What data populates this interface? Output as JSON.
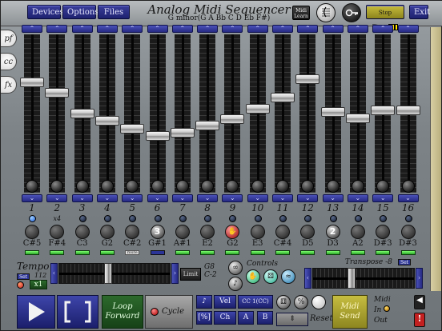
{
  "header": {
    "title": "Analog Midi Sequencer",
    "scale": "G minor(G A Bb C D Eb F#)",
    "buttons": {
      "devices": "Devices",
      "options": "Options",
      "files": "Files",
      "midi_learn": "Midi Learn",
      "stop_time": "Stop Time",
      "exit": "Exit"
    }
  },
  "side_tabs": [
    "pf",
    "cc",
    "fx"
  ],
  "channels": [
    {
      "num": "1",
      "note": "C#5",
      "fader": 0.71,
      "dot": "active",
      "dice": "",
      "led": "on"
    },
    {
      "num": "2",
      "note": "F#4",
      "fader": 0.64,
      "dot": "x4",
      "dice": "",
      "led": "on"
    },
    {
      "num": "3",
      "note": "C3",
      "fader": 0.5,
      "dot": "",
      "dice": "",
      "led": "on"
    },
    {
      "num": "4",
      "note": "G2",
      "fader": 0.45,
      "dot": "",
      "dice": "",
      "led": "on"
    },
    {
      "num": "5",
      "note": "C#2",
      "fader": 0.4,
      "dot": "",
      "dice": "",
      "led": "mute"
    },
    {
      "num": "6",
      "note": "G#1",
      "fader": 0.35,
      "dot": "",
      "dice": "3",
      "led": "off"
    },
    {
      "num": "7",
      "note": "A#1",
      "fader": 0.37,
      "dot": "",
      "dice": "",
      "led": "on"
    },
    {
      "num": "8",
      "note": "E2",
      "fader": 0.42,
      "dot": "",
      "dice": "",
      "led": "on"
    },
    {
      "num": "9",
      "note": "G2",
      "fader": 0.46,
      "dot": "",
      "dice": "glove",
      "led": "on"
    },
    {
      "num": "10",
      "note": "E3",
      "fader": 0.53,
      "dot": "",
      "dice": "",
      "led": "on"
    },
    {
      "num": "11",
      "note": "C#4",
      "fader": 0.61,
      "dot": "",
      "dice": "",
      "led": "on"
    },
    {
      "num": "12",
      "note": "D5",
      "fader": 0.73,
      "dot": "",
      "dice": "",
      "led": "on"
    },
    {
      "num": "13",
      "note": "D3",
      "fader": 0.51,
      "dot": "",
      "dice": "2",
      "led": "on"
    },
    {
      "num": "14",
      "note": "A2",
      "fader": 0.47,
      "dot": "",
      "dice": "",
      "led": "on"
    },
    {
      "num": "15",
      "note": "D#3",
      "fader": 0.52,
      "dot": "",
      "dice": "",
      "led": "on"
    },
    {
      "num": "16",
      "note": "D#3",
      "fader": 0.52,
      "dot": "",
      "dice": "",
      "led": "on"
    }
  ],
  "tempo": {
    "label": "Tempo",
    "set": "Set",
    "value": "112",
    "multiplier": "x1",
    "slider": 0.44
  },
  "limit": {
    "label": "Limit",
    "hi": "G8",
    "lo": "C-2"
  },
  "controls": {
    "label": "Controls"
  },
  "transpose": {
    "label": "Transpose -8",
    "set": "Set",
    "slider": 0.37
  },
  "transport": {
    "loop": [
      "Loop",
      "Forward"
    ],
    "cycle": "Cycle",
    "vel": "Vel",
    "ch": "Ch",
    "pct": "[%]",
    "cc": "CC 1(CC)",
    "a": "A",
    "b": "B",
    "reset": "Reset",
    "midi_send": [
      "Midi",
      "Send"
    ],
    "midi_io": [
      "Midi",
      "In",
      "Out"
    ]
  }
}
